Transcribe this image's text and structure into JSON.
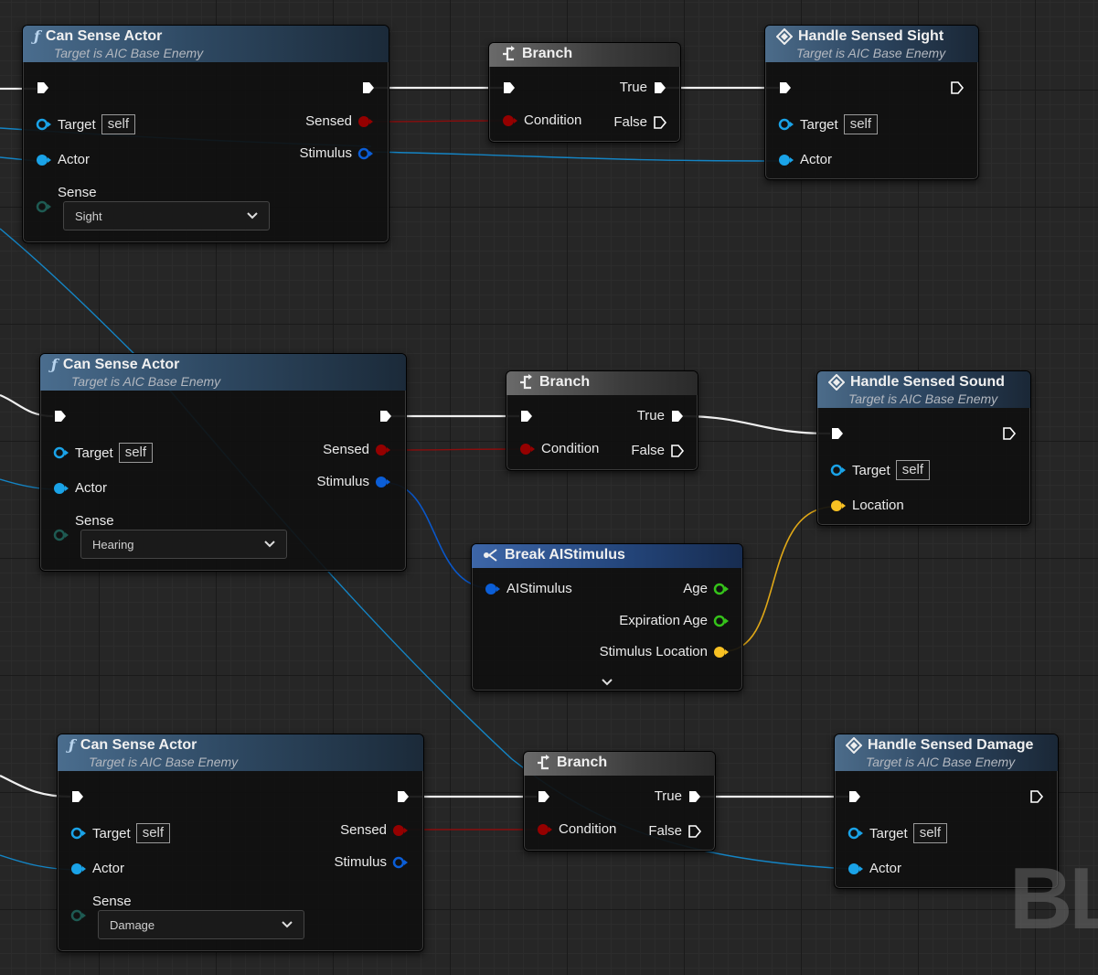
{
  "labels": {
    "exec_pin": "Execution pin",
    "self": "self",
    "target": "Target",
    "actor": "Actor",
    "sense": "Sense",
    "sensed": "Sensed",
    "stimulus": "Stimulus",
    "condition": "Condition",
    "true": "True",
    "false": "False",
    "location": "Location"
  },
  "nodes": {
    "can_sense_1": {
      "title": "Can Sense Actor",
      "subtitle": "Target is AIC Base Enemy",
      "sense_value": "Sight"
    },
    "can_sense_2": {
      "title": "Can Sense Actor",
      "subtitle": "Target is AIC Base Enemy",
      "sense_value": "Hearing"
    },
    "can_sense_3": {
      "title": "Can Sense Actor",
      "subtitle": "Target is AIC Base Enemy",
      "sense_value": "Damage"
    },
    "branch_1": {
      "title": "Branch"
    },
    "branch_2": {
      "title": "Branch"
    },
    "branch_3": {
      "title": "Branch"
    },
    "handle_sight": {
      "title": "Handle Sensed Sight",
      "subtitle": "Target is AIC Base Enemy"
    },
    "handle_sound": {
      "title": "Handle Sensed Sound",
      "subtitle": "Target is AIC Base Enemy"
    },
    "handle_damage": {
      "title": "Handle Sensed Damage",
      "subtitle": "Target is AIC Base Enemy"
    },
    "break_stimulus": {
      "title": "Break AIStimulus",
      "input": "AIStimulus",
      "out_age": "Age",
      "out_expiration": "Expiration Age",
      "out_location": "Stimulus Location"
    }
  },
  "watermark": "BL",
  "colors": {
    "exec": "#ffffff",
    "object_pin": "#1aa3e8",
    "bool_pin": "#950000",
    "struct_pin": "#0b5ed7",
    "float_pin": "#35c21a",
    "vector_pin": "#f8c123",
    "sense_pin": "#1e5a52"
  }
}
